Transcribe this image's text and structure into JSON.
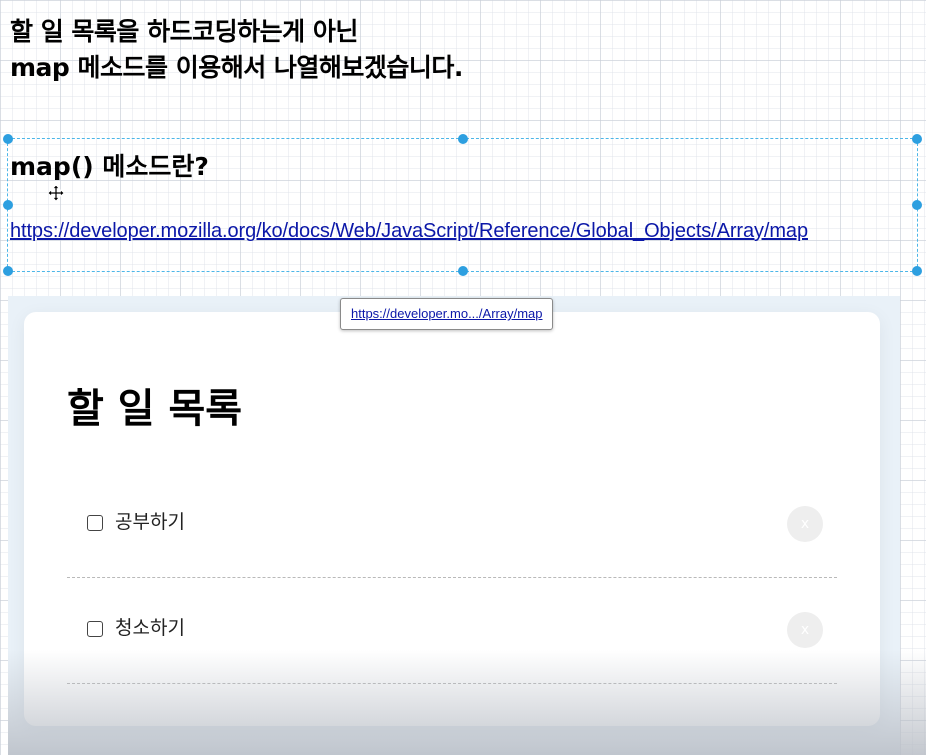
{
  "slide": {
    "heading_line1": "할 일 목록을 하드코딩하는게 아닌",
    "heading_line2": "map 메소드를 이용해서 나열해보겠습니다.",
    "sub_heading": "map() 메소드란?",
    "link_text": "https://developer.mozilla.org/ko/docs/Web/JavaScript/Reference/Global_Objects/Array/map",
    "tooltip_text": "https://developer.mo.../Array/map"
  },
  "todo_app": {
    "title": "할 일 목록",
    "items": [
      {
        "label": "공부하기",
        "checked": false,
        "delete_label": "x"
      },
      {
        "label": "청소하기",
        "checked": false,
        "delete_label": "x"
      }
    ]
  },
  "colors": {
    "selection_accent": "#2d9fe0",
    "link": "#0b17a8",
    "delete_button_bg": "#eeeeee"
  },
  "icons": {
    "cursor": "move-cursor-icon",
    "selection": "selection-handle-icon"
  }
}
